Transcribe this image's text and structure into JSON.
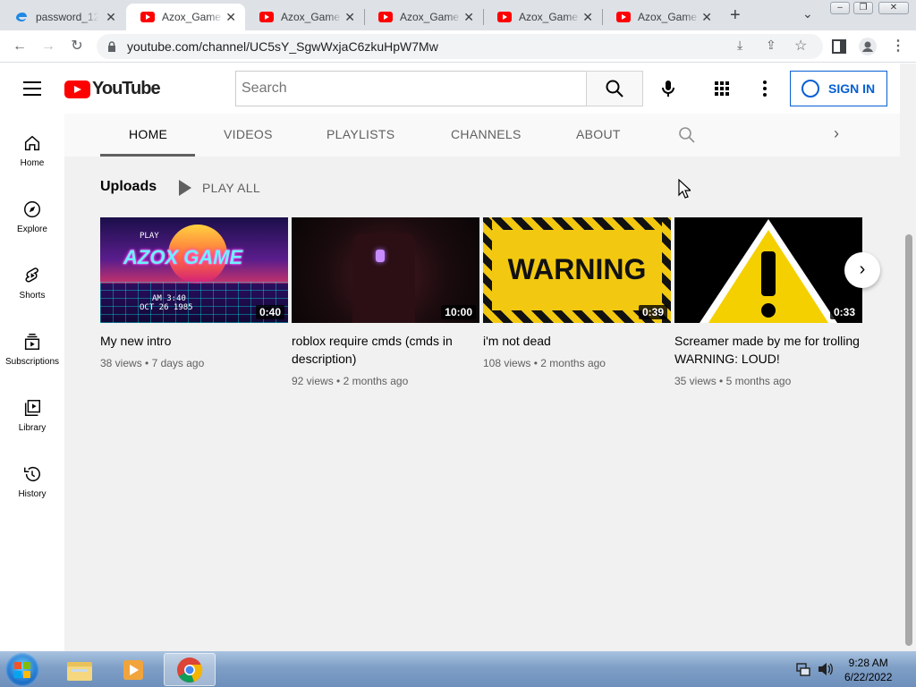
{
  "browser": {
    "tabs": [
      {
        "title": "password_12",
        "favicon": "edge-icon",
        "active": false
      },
      {
        "title": "Azox_Game",
        "favicon": "youtube-icon",
        "active": true
      },
      {
        "title": "Azox_Game",
        "favicon": "youtube-icon",
        "active": false
      },
      {
        "title": "Azox_Game",
        "favicon": "youtube-icon",
        "active": false
      },
      {
        "title": "Azox_Game",
        "favicon": "youtube-icon",
        "active": false
      },
      {
        "title": "Azox_Game",
        "favicon": "youtube-icon",
        "active": false
      }
    ],
    "url": "youtube.com/channel/UC5sY_SgwWxjaC6zkuHpW7Mw"
  },
  "youtube": {
    "logo_text": "YouTube",
    "search_placeholder": "Search",
    "sign_in_label": "SIGN IN"
  },
  "guide": [
    {
      "label": "Home",
      "icon": "home-icon"
    },
    {
      "label": "Explore",
      "icon": "compass-icon"
    },
    {
      "label": "Shorts",
      "icon": "shorts-icon"
    },
    {
      "label": "Subscriptions",
      "icon": "subscriptions-icon"
    },
    {
      "label": "Library",
      "icon": "library-icon"
    },
    {
      "label": "History",
      "icon": "history-icon"
    }
  ],
  "channel_tabs": [
    "HOME",
    "VIDEOS",
    "PLAYLISTS",
    "CHANNELS",
    "ABOUT"
  ],
  "uploads": {
    "heading": "Uploads",
    "play_all": "PLAY ALL",
    "videos": [
      {
        "title": "My new intro",
        "duration": "0:40",
        "views": "38 views",
        "age": "7 days ago",
        "thumb_title": "AZOX GAME",
        "thumb_play": "PLAY",
        "thumb_time": "AM  3:40",
        "thumb_date": "OCT 26 1985"
      },
      {
        "title": "roblox require cmds (cmds in description)",
        "duration": "10:00",
        "views": "92 views",
        "age": "2 months ago"
      },
      {
        "title": "i'm not dead",
        "duration": "0:39",
        "views": "108 views",
        "age": "2 months ago",
        "thumb_text": "WARNING"
      },
      {
        "title": "Screamer made by me for trolling WARNING: LOUD!",
        "duration": "0:33",
        "views": "35 views",
        "age": "5 months ago"
      }
    ]
  },
  "taskbar": {
    "time": "9:28 AM",
    "date": "6/22/2022"
  }
}
